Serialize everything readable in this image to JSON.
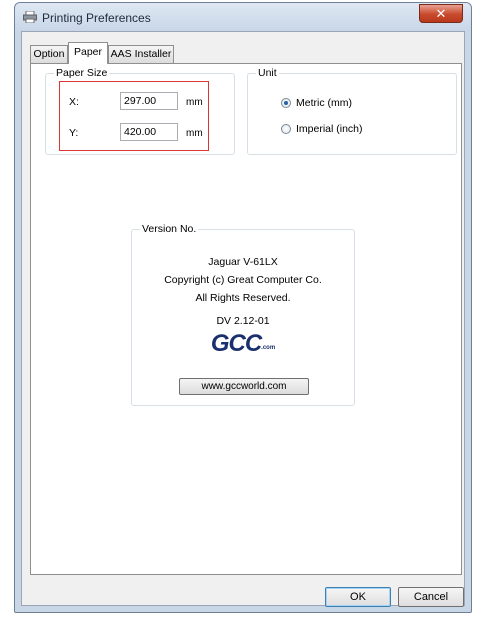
{
  "window": {
    "title": "Printing Preferences",
    "close_glyph": "✕"
  },
  "tabs": [
    {
      "label": "Option"
    },
    {
      "label": "Paper"
    },
    {
      "label": "AAS Installer"
    }
  ],
  "paper_size": {
    "title": "Paper Size",
    "x_label": "X:",
    "x_value": "297.00",
    "x_unit": "mm",
    "y_label": "Y:",
    "y_value": "420.00",
    "y_unit": "mm"
  },
  "unit": {
    "title": "Unit",
    "options": [
      {
        "label": "Metric (mm)",
        "selected": true
      },
      {
        "label": "Imperial (inch)",
        "selected": false
      }
    ]
  },
  "version": {
    "title": "Version No.",
    "model": "Jaguar V-61LX",
    "copyright": "Copyright (c) Great Computer Co.",
    "rights": "All Rights Reserved.",
    "number": "DV 2.12-01",
    "logo_text": "GCC",
    "logo_tail": ".com",
    "website_button": "www.gccworld.com"
  },
  "buttons": {
    "ok": "OK",
    "cancel": "Cancel"
  },
  "colors": {
    "highlight": "#d9372f",
    "logo": "#1b2f6e",
    "radio_selected": "#2a5fa8"
  },
  "icons": {
    "title": "printer-icon",
    "close": "close-icon"
  }
}
